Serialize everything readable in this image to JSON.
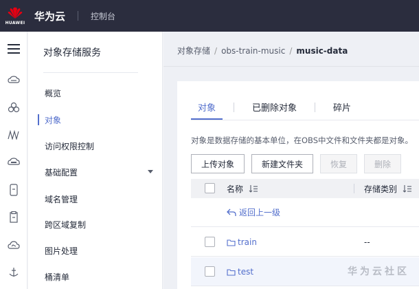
{
  "topbar": {
    "logo_text": "HUAWEI",
    "brand": "华为云",
    "console": "控制台"
  },
  "rail": {
    "icons": [
      "menu-icon",
      "cloud-server-icon",
      "cluster-icon",
      "network-icon",
      "storage-icon",
      "phone-icon",
      "document-icon",
      "cloud-check-icon",
      "anchor-icon"
    ]
  },
  "service_nav": {
    "title": "对象存储服务",
    "items": [
      {
        "label": "概览"
      },
      {
        "label": "对象"
      },
      {
        "label": "访问权限控制"
      },
      {
        "label": "基础配置"
      },
      {
        "label": "域名管理"
      },
      {
        "label": "跨区域复制"
      },
      {
        "label": "图片处理"
      },
      {
        "label": "桶清单"
      }
    ],
    "active_index": 1
  },
  "breadcrumb": {
    "items": [
      "对象存储",
      "obs-train-music",
      "music-data"
    ],
    "separator": "/"
  },
  "tabs": [
    {
      "label": "对象"
    },
    {
      "label": "已删除对象"
    },
    {
      "label": "碎片"
    }
  ],
  "description": "对象是数据存储的基本单位，在OBS中文件和文件夹都是对象。",
  "toolbar": {
    "upload": "上传对象",
    "new_folder": "新建文件夹",
    "restore": "恢复",
    "delete": "删除"
  },
  "table": {
    "columns": [
      "名称",
      "存储类别"
    ],
    "back_label": "返回上一级",
    "rows": [
      {
        "name": "train",
        "storage_class": "--"
      },
      {
        "name": "test",
        "storage_class": ""
      }
    ]
  },
  "watermark": "华为云社区",
  "colors": {
    "topbar": "#2b2d3e",
    "accent": "#526ecc"
  }
}
